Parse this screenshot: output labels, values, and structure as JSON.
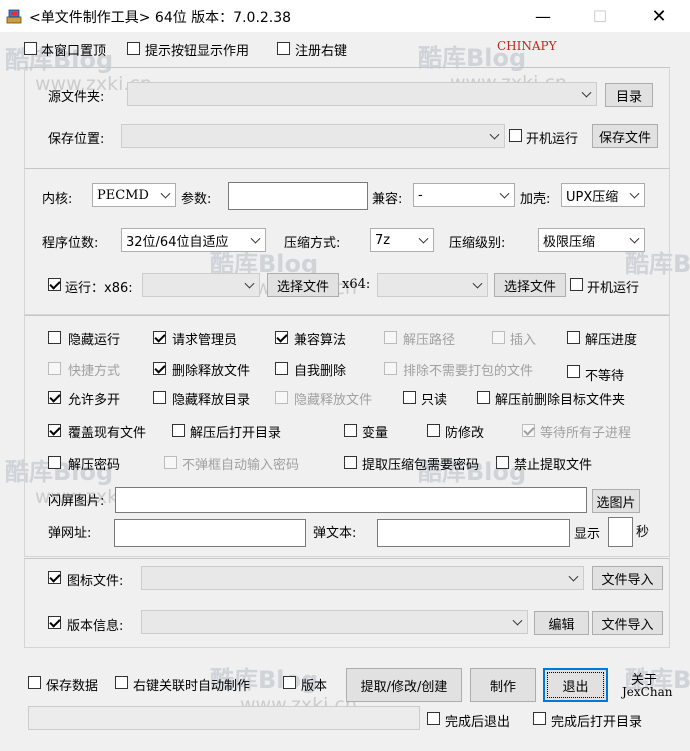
{
  "window": {
    "title": "<单文件制作工具> 64位 版本：7.0.2.38",
    "minimize": "—",
    "maximize": "☐",
    "close": "✕"
  },
  "top": {
    "cb_topmost": "本窗口置顶",
    "cb_hint": "提示按钮显示作用",
    "cb_register": "注册右键",
    "brand": "CHINAPY"
  },
  "source": {
    "source_label": "源文件夹:",
    "dir_button": "目录",
    "save_label": "保存位置:",
    "autorun": "开机运行",
    "save_button": "保存文件"
  },
  "kernel": {
    "kernel_label": "内核:",
    "kernel_value": "PECMD",
    "params_label": "参数:",
    "compat_label": "兼容:",
    "compat_value": "-",
    "shell_label": "加壳:",
    "shell_value": "UPX压缩",
    "bits_label": "程序位数:",
    "bits_value": "32位/64位自适应",
    "compress_label": "压缩方式:",
    "compress_value": "7z",
    "level_label": "压缩级别:",
    "level_value": "极限压缩",
    "run_label": "运行：x86:",
    "select_file": "选择文件",
    "x64_label": "x64:",
    "autorun2": "开机运行"
  },
  "options": {
    "hide_run": "隐藏运行",
    "request_admin": "请求管理员",
    "compat_algo": "兼容算法",
    "extract_path": "解压路径",
    "insert": "插入",
    "extract_progress": "解压进度",
    "shortcut": "快捷方式",
    "delete_released": "删除释放文件",
    "self_delete": "自我删除",
    "exclude_packing": "排除不需要打包的文件",
    "no_wait": "不等待",
    "allow_multi": "允许多开",
    "hide_release_dir": "隐藏释放目录",
    "hide_release_file": "隐藏释放文件",
    "read_only": "只读",
    "delete_target_before": "解压前删除目标文件夹",
    "overwrite": "覆盖现有文件",
    "open_dir_after": "解压后打开目录",
    "variable": "变量",
    "anti_modify": "防修改",
    "wait_children": "等待所有子进程",
    "extract_password": "解压密码",
    "no_popup_password": "不弹框自动输入密码",
    "extract_need_password": "提取压缩包需要密码",
    "forbid_extract": "禁止提取文件",
    "splash_label": "闪屏图片:",
    "select_image": "选图片",
    "popup_url_label": "弹网址:",
    "popup_text_label": "弹文本:",
    "show_label": "显示",
    "seconds_label": "秒"
  },
  "icon_section": {
    "icon_label": "图标文件:",
    "file_import": "文件导入",
    "version_label": "版本信息:",
    "edit_button": "编辑",
    "file_import2": "文件导入"
  },
  "bottom": {
    "save_data": "保存数据",
    "right_click_auto": "右键关联时自动制作",
    "version": "版本",
    "extract_btn": "提取/修改/创建",
    "make_btn": "制作",
    "exit_btn": "退出",
    "about": "关于",
    "author": "JexChan",
    "exit_after": "完成后退出",
    "open_dir_after_done": "完成后打开目录"
  },
  "watermark": {
    "logo": "酷库Blog",
    "url": "www.zxki.cn"
  }
}
